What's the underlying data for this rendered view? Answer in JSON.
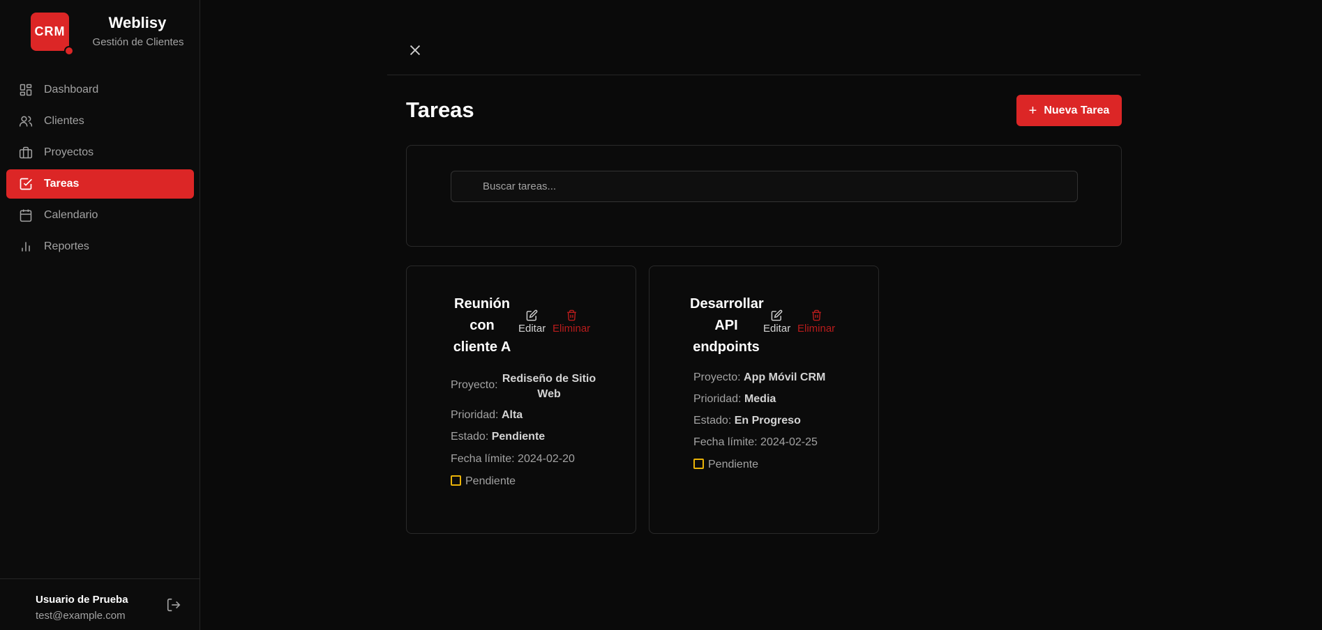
{
  "brand": {
    "logo_text": "CRM",
    "name": "Weblisy",
    "subtitle": "Gestión de Clientes"
  },
  "nav": [
    {
      "label": "Dashboard",
      "icon": "grid-icon",
      "active": false
    },
    {
      "label": "Clientes",
      "icon": "users-icon",
      "active": false
    },
    {
      "label": "Proyectos",
      "icon": "briefcase-icon",
      "active": false
    },
    {
      "label": "Tareas",
      "icon": "check-square-icon",
      "active": true
    },
    {
      "label": "Calendario",
      "icon": "calendar-icon",
      "active": false
    },
    {
      "label": "Reportes",
      "icon": "bar-chart-icon",
      "active": false
    }
  ],
  "user": {
    "name": "Usuario de Prueba",
    "email": "test@example.com"
  },
  "main": {
    "title": "Tareas",
    "new_button": "Nueva Tarea",
    "search_placeholder": "Buscar tareas..."
  },
  "tasks": [
    {
      "title_lines": [
        "Reunión",
        "con",
        "cliente A"
      ],
      "edit": "Editar",
      "delete": "Eliminar",
      "project_label": "Proyecto:",
      "project_lines": [
        "Rediseño de Sitio",
        "Web"
      ],
      "priority_label": "Prioridad:",
      "priority": "Alta",
      "status_label": "Estado:",
      "status": "Pendiente",
      "due_label": "Fecha límite:",
      "due": "2024-02-20",
      "check_label": "Pendiente"
    },
    {
      "title_lines": [
        "Desarrollar",
        "API",
        "endpoints"
      ],
      "edit": "Editar",
      "delete": "Eliminar",
      "project_label": "Proyecto:",
      "project": "App Móvil CRM",
      "priority_label": "Prioridad:",
      "priority": "Media",
      "status_label": "Estado:",
      "status": "En Progreso",
      "due_label": "Fecha límite:",
      "due": "2024-02-25",
      "check_label": "Pendiente"
    }
  ],
  "colors": {
    "accent": "#dc2626",
    "background": "#0a0a0a",
    "pending": "#eab308"
  }
}
